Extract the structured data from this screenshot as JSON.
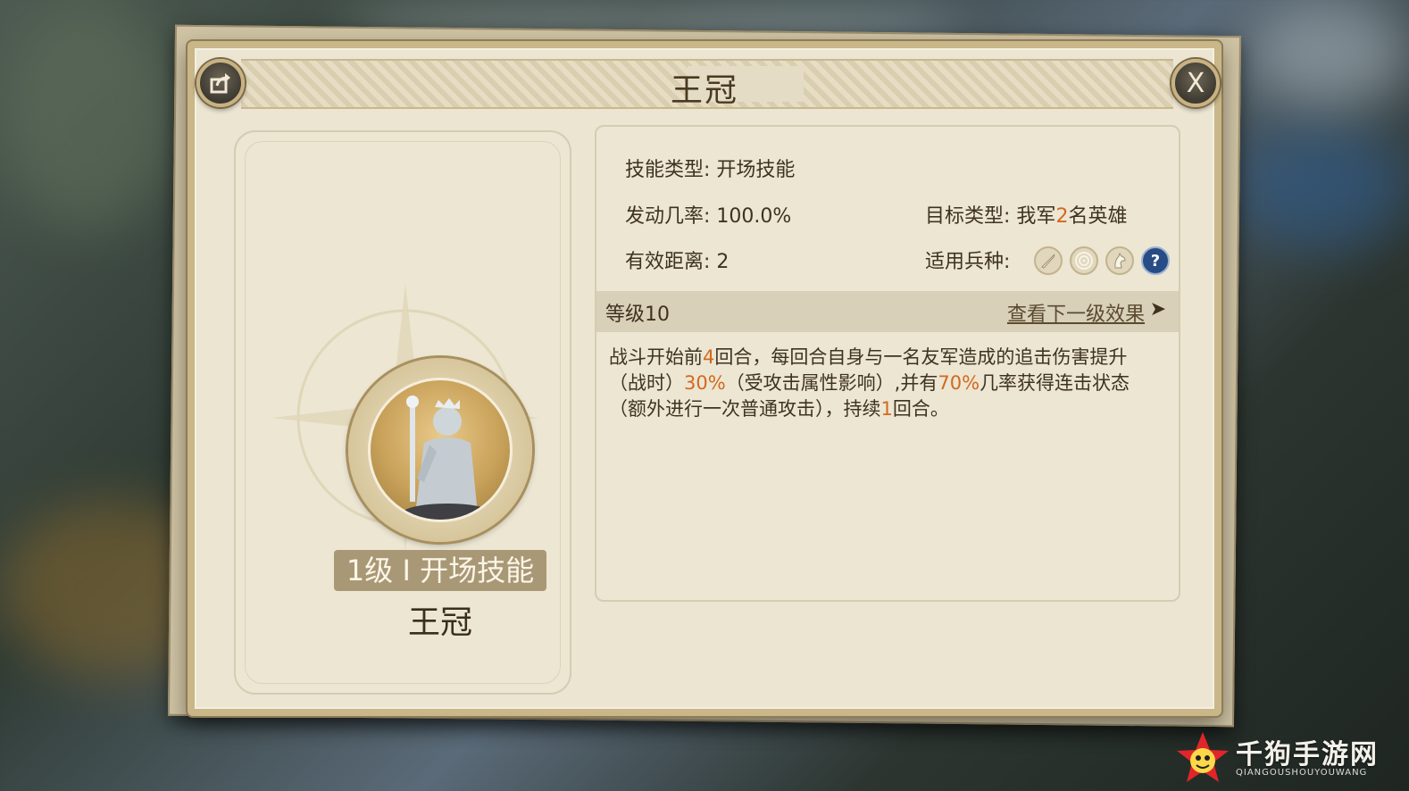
{
  "window": {
    "title": "王冠"
  },
  "header": {
    "share_icon": "share-icon",
    "close_label": "X"
  },
  "skill_card": {
    "level_badge": "1级 I 开场技能",
    "name": "王冠",
    "portrait_icon": "crowned-queen-statue-icon"
  },
  "details": {
    "skill_type": {
      "label": "技能类型:",
      "value": "开场技能"
    },
    "trigger_rate": {
      "label": "发动几率:",
      "value": "100.0%"
    },
    "target_type": {
      "label": "目标类型:",
      "value_prefix": "我军",
      "value_number": "2",
      "value_suffix": "名英雄"
    },
    "range": {
      "label": "有效距离:",
      "value": "2"
    },
    "troop_types": {
      "label": "适用兵种:",
      "icons": [
        "sword-icon",
        "target-icon",
        "horse-icon",
        "question-icon"
      ]
    }
  },
  "level_section": {
    "level": "等级10",
    "next_link": "查看下一级效果",
    "arrow": "➤"
  },
  "description": {
    "p1": "战斗开始前",
    "n1": "4",
    "p2": "回合，每回合自身与一名友军造成的追击伤害提升（战时）",
    "n2": "30%",
    "p3": "（受攻击属性影响）,并有",
    "n3": "70%",
    "p4": "几率获得连击状态（额外进行一次普通攻击），持续",
    "n4": "1",
    "p5": "回合。"
  },
  "watermark": {
    "text": "千狗手游网",
    "sub": "QIANGOUSHOUYOUWANG"
  },
  "colors": {
    "highlight": "#d2691e",
    "panel": "#ebe5d2",
    "frame": "#c9b689"
  }
}
